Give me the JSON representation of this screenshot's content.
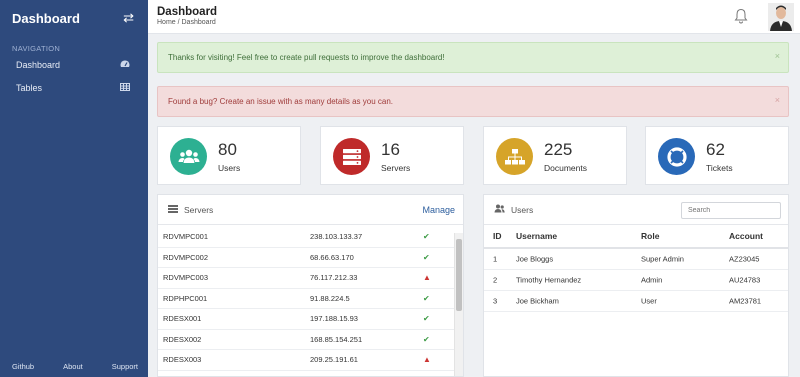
{
  "sidebar": {
    "title": "Dashboard",
    "toggle_icon": "swap-icon",
    "section": "NAVIGATION",
    "items": [
      {
        "label": "Dashboard",
        "icon": "tachometer-icon"
      },
      {
        "label": "Tables",
        "icon": "table-icon"
      }
    ],
    "footer": [
      "Github",
      "About",
      "Support"
    ]
  },
  "header": {
    "title": "Dashboard",
    "breadcrumb": "Home / Dashboard"
  },
  "alerts": {
    "success": "Thanks for visiting! Feel free to create pull requests to improve the dashboard!",
    "danger": "Found a bug? Create an issue with as many details as you can.",
    "close": "×"
  },
  "stats": [
    {
      "value": "80",
      "label": "Users",
      "color": "#2db092",
      "icon": "users-icon"
    },
    {
      "value": "16",
      "label": "Servers",
      "color": "#bf2a2a",
      "icon": "server-icon"
    },
    {
      "value": "225",
      "label": "Documents",
      "color": "#d6a429",
      "icon": "sitemap-icon"
    },
    {
      "value": "62",
      "label": "Tickets",
      "color": "#2969b8",
      "icon": "life-ring-icon"
    }
  ],
  "servers": {
    "title": "Servers",
    "manage": "Manage",
    "rows": [
      {
        "name": "RDVMPC001",
        "ip": "238.103.133.37",
        "status": "ok"
      },
      {
        "name": "RDVMPC002",
        "ip": "68.66.63.170",
        "status": "ok"
      },
      {
        "name": "RDVMPC003",
        "ip": "76.117.212.33",
        "status": "warn"
      },
      {
        "name": "RDPHPC001",
        "ip": "91.88.224.5",
        "status": "ok"
      },
      {
        "name": "RDESX001",
        "ip": "197.188.15.93",
        "status": "ok"
      },
      {
        "name": "RDESX002",
        "ip": "168.85.154.251",
        "status": "ok"
      },
      {
        "name": "RDESX003",
        "ip": "209.25.191.61",
        "status": "warn"
      }
    ]
  },
  "users": {
    "title": "Users",
    "search_placeholder": "Search",
    "columns": [
      "ID",
      "Username",
      "Role",
      "Account"
    ],
    "rows": [
      [
        "1",
        "Joe Bloggs",
        "Super Admin",
        "AZ23045"
      ],
      [
        "2",
        "Timothy Hernandez",
        "Admin",
        "AU24783"
      ],
      [
        "3",
        "Joe Bickham",
        "User",
        "AM23781"
      ]
    ]
  }
}
